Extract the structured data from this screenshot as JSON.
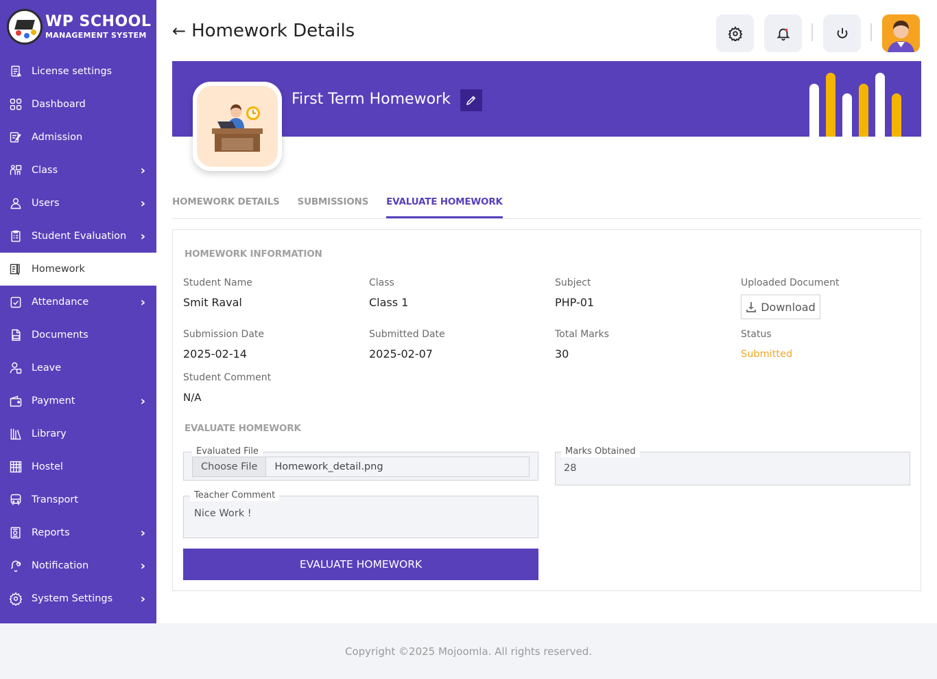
{
  "app": {
    "logo_title": "WP SCHOOL",
    "logo_subtitle": "MANAGEMENT SYSTEM"
  },
  "sidebar": {
    "items": [
      {
        "label": "License settings",
        "icon": "license-icon",
        "chevron": false
      },
      {
        "label": "Dashboard",
        "icon": "grid-icon",
        "chevron": false
      },
      {
        "label": "Admission",
        "icon": "admission-icon",
        "chevron": false
      },
      {
        "label": "Class",
        "icon": "class-icon",
        "chevron": true
      },
      {
        "label": "Users",
        "icon": "user-icon",
        "chevron": true
      },
      {
        "label": "Student Evaluation",
        "icon": "clipboard-icon",
        "chevron": true
      },
      {
        "label": "Homework",
        "icon": "homework-icon",
        "chevron": false,
        "active": true
      },
      {
        "label": "Attendance",
        "icon": "check-calendar-icon",
        "chevron": true
      },
      {
        "label": "Documents",
        "icon": "document-icon",
        "chevron": false
      },
      {
        "label": "Leave",
        "icon": "leave-icon",
        "chevron": false
      },
      {
        "label": "Payment",
        "icon": "wallet-icon",
        "chevron": true
      },
      {
        "label": "Library",
        "icon": "library-icon",
        "chevron": false
      },
      {
        "label": "Hostel",
        "icon": "hostel-icon",
        "chevron": false
      },
      {
        "label": "Transport",
        "icon": "bus-icon",
        "chevron": false
      },
      {
        "label": "Reports",
        "icon": "report-icon",
        "chevron": true
      },
      {
        "label": "Notification",
        "icon": "notification-icon",
        "chevron": true
      },
      {
        "label": "System Settings",
        "icon": "gear-icon",
        "chevron": true
      }
    ]
  },
  "header": {
    "title": "Homework Details"
  },
  "banner": {
    "title": "First Term Homework"
  },
  "tabs": [
    {
      "label": "HOMEWORK DETAILS",
      "active": false
    },
    {
      "label": "SUBMISSIONS",
      "active": false
    },
    {
      "label": "EVALUATE HOMEWORK",
      "active": true
    }
  ],
  "info": {
    "section_title": "HOMEWORK INFORMATION",
    "student_name_label": "Student Name",
    "student_name": "Smit Raval",
    "class_label": "Class",
    "class": "Class 1",
    "subject_label": "Subject",
    "subject": "PHP-01",
    "uploaded_doc_label": "Uploaded Document",
    "download_label": "Download",
    "submission_date_label": "Submission Date",
    "submission_date": "2025-02-14",
    "submitted_date_label": "Submitted Date",
    "submitted_date": "2025-02-07",
    "total_marks_label": "Total Marks",
    "total_marks": "30",
    "status_label": "Status",
    "status": "Submitted",
    "student_comment_label": "Student Comment",
    "student_comment": "N/A"
  },
  "evaluate": {
    "section_title": "EVALUATE HOMEWORK",
    "evaluated_file_label": "Evaluated File",
    "choose_file_label": "Choose File",
    "file_name": "Homework_detail.png",
    "marks_label": "Marks Obtained",
    "marks_value": "28",
    "teacher_comment_label": "Teacher Comment",
    "teacher_comment": "Nice Work !",
    "submit_label": "EVALUATE HOMEWORK"
  },
  "footer": {
    "copyright": "Copyright ©2025 Mojoomla. All rights reserved."
  },
  "colors": {
    "primary": "#5840bb",
    "accent_bar": "#f4b400",
    "status": "#f5a623"
  }
}
